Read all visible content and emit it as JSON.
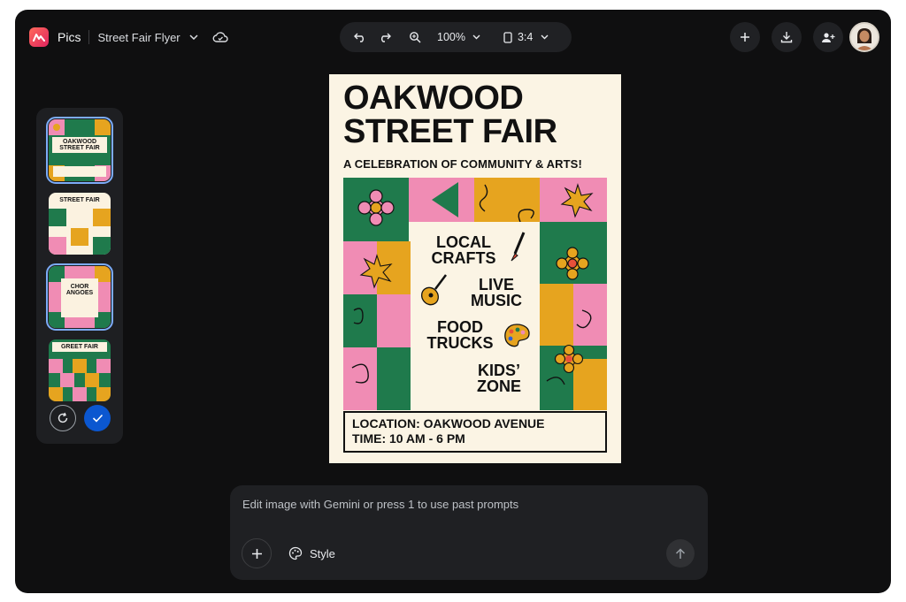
{
  "header": {
    "app_name": "Pics",
    "doc_title": "Street Fair Flyer",
    "zoom": "100%",
    "aspect_ratio": "3:4"
  },
  "poster": {
    "title_line1": "OAKWOOD",
    "title_line2": "STREET FAIR",
    "subtitle": "A CELEBRATION OF COMMUNITY & ARTS!",
    "items": [
      {
        "line1": "LOCAL",
        "line2": "CRAFTS"
      },
      {
        "line1": "LIVE",
        "line2": "MUSIC"
      },
      {
        "line1": "FOOD",
        "line2": "TRUCKS"
      },
      {
        "line1": "KIDS’",
        "line2": "ZONE"
      }
    ],
    "location": "LOCATION: OAKWOOD AVENUE",
    "time": "TIME: 10 AM - 6 PM"
  },
  "versions": [
    {
      "heading": "OAKWOOD STREET FAIR",
      "selected": true
    },
    {
      "heading": "STREET FAIR",
      "selected": false
    },
    {
      "heading": "CHOR ANGOES",
      "selected": true
    },
    {
      "heading": "GREET FAIR",
      "selected": false
    }
  ],
  "prompt": {
    "placeholder": "Edit image with Gemini or press 1 to use past prompts",
    "style_label": "Style"
  },
  "colors": {
    "pink": "#f08cb4",
    "green": "#1f7a4c",
    "mustard": "#e6a41f",
    "cream": "#fbf4e4",
    "accent_blue": "#0b57d0"
  },
  "icons": [
    "logo-icon",
    "chevron-down-icon",
    "cloud-icon",
    "undo-icon",
    "redo-icon",
    "zoom-icon",
    "aspect-ratio-icon",
    "plus-icon",
    "download-icon",
    "add-person-icon",
    "refresh-icon",
    "check-icon",
    "palette-icon",
    "send-arrow-icon"
  ]
}
